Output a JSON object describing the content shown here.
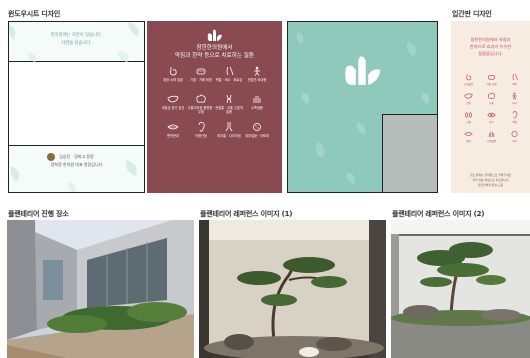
{
  "sections": {
    "window_design": "윈도우시트 디자인",
    "entrance_design": "입간판 디자인",
    "venue": "플랜테리어 진행 장소",
    "ref1": "플랜테리어 레퍼런스 이미지 (1)",
    "ref2": "플랜테리어 레퍼런스 이미지 (2)"
  },
  "window_sheet": {
    "message_line1": "한의원에는 자연이 있습니다.",
    "message_line2": "자연을 담습니다.",
    "signature_line1": "김상진 · 경희고 원장",
    "signature_line2": "경희정 한의원 대표 원장입니다"
  },
  "maroon_panel": {
    "title_line1": "참한한의원에서",
    "title_line2": "약침과 한약 등으로 치료하는 질환",
    "items": [
      {
        "icon": "stomach-icon",
        "label": "위장 소화 질환"
      },
      {
        "icon": "mask-icon",
        "label": "기침 · 가래 비염"
      },
      {
        "icon": "neck-icon",
        "label": "목통 · 비소 · 피로감 ·"
      },
      {
        "icon": "body-icon",
        "label": "전립선 비대증"
      },
      {
        "icon": "liver-icon",
        "label": "대장균 장기 검진"
      },
      {
        "icon": "brain-icon",
        "label": "두통어지럼 불면증 · 우울"
      },
      {
        "icon": "joint-icon",
        "label": "관절통 · 요통 근골격 통증"
      },
      {
        "icon": "hand-icon",
        "label": "수족냉증"
      },
      {
        "icon": "lips-icon",
        "label": "면역관계"
      },
      {
        "icon": "ear-icon",
        "label": "이명난청"
      },
      {
        "icon": "leg-icon",
        "label": "하지통 · 다리저림"
      },
      {
        "icon": "skin-icon",
        "label": "피부질환 · 아토피"
      }
    ]
  },
  "entrance_panel": {
    "title_line1": "참한한의원에서 약침과",
    "title_line2": "한약으로 효과가 우수한",
    "title_line3": "질환들입니다.",
    "items": [
      {
        "icon": "stomach-icon",
        "label": "소화불량"
      },
      {
        "icon": "mask-icon",
        "label": "기침 가래"
      },
      {
        "icon": "neck-icon",
        "label": "목통"
      },
      {
        "icon": "liver-icon",
        "label": "간장"
      },
      {
        "icon": "brain-icon",
        "label": "두통"
      },
      {
        "icon": "body-icon",
        "label": "하지"
      },
      {
        "icon": "kidney-icon",
        "label": "신장"
      },
      {
        "icon": "eye-icon",
        "label": "안구"
      },
      {
        "icon": "ear-icon",
        "label": "이명"
      },
      {
        "icon": "lips-icon",
        "label": "면역"
      },
      {
        "icon": "hand-icon",
        "label": "수족냉증"
      },
      {
        "icon": "skin-icon",
        "label": "피부"
      }
    ],
    "foot_line1": "진료 문의는 한의원으로 연락주세요",
    "foot_line2": "환자 맞춤 처방으로 치료합니다",
    "foot_line3": "참한한의원 원장 드림"
  },
  "colors": {
    "maroon": "#8a4a52",
    "mint": "#8fc9bb",
    "cream": "#f6ece1",
    "accent_green": "#6aa394"
  }
}
